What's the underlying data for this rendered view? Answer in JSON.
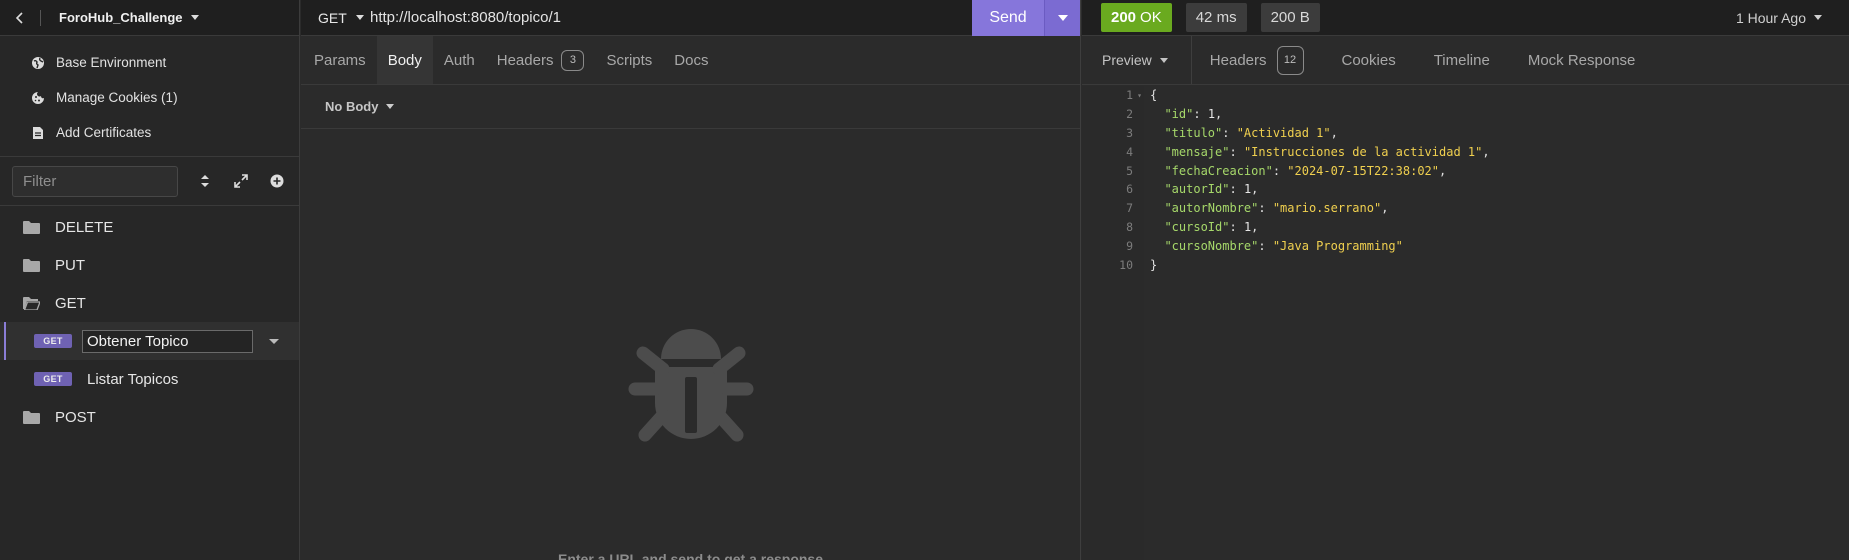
{
  "app": {
    "project_name": "ForoHub_Challenge"
  },
  "sidebar": {
    "menu": [
      {
        "label": "Base Environment",
        "icon": "globe-icon"
      },
      {
        "label": "Manage Cookies (1)",
        "icon": "cookie-icon"
      },
      {
        "label": "Add Certificates",
        "icon": "certificate-icon"
      }
    ],
    "filter_placeholder": "Filter",
    "tree": [
      {
        "type": "folder",
        "label": "DELETE",
        "open": false
      },
      {
        "type": "folder",
        "label": "PUT",
        "open": false
      },
      {
        "type": "folder",
        "label": "GET",
        "open": true
      },
      {
        "type": "request",
        "method": "GET",
        "label": "Obtener Topico",
        "active": true,
        "editing": true
      },
      {
        "type": "request",
        "method": "GET",
        "label": "Listar Topicos",
        "active": false
      },
      {
        "type": "folder",
        "label": "POST",
        "open": false
      }
    ]
  },
  "request": {
    "method": "GET",
    "url": "http://localhost:8080/topico/1",
    "send_label": "Send",
    "tabs": [
      {
        "label": "Params",
        "active": false
      },
      {
        "label": "Body",
        "active": true
      },
      {
        "label": "Auth",
        "active": false
      },
      {
        "label": "Headers",
        "active": false,
        "count": "3"
      },
      {
        "label": "Scripts",
        "active": false
      },
      {
        "label": "Docs",
        "active": false
      }
    ],
    "body_type": "No Body",
    "empty_hint": "Enter a URL and send to get a response"
  },
  "response": {
    "status": {
      "code": "200",
      "text": "OK"
    },
    "time": "42 ms",
    "size": "200 B",
    "time_ago": "1 Hour Ago",
    "preview_label": "Preview",
    "tabs": [
      {
        "label": "Headers",
        "count": "12"
      },
      {
        "label": "Cookies"
      },
      {
        "label": "Timeline"
      },
      {
        "label": "Mock Response"
      }
    ],
    "json_lines": [
      {
        "n": "1",
        "fold": true,
        "parts": [
          {
            "t": "p",
            "v": "{"
          }
        ]
      },
      {
        "n": "2",
        "parts": [
          {
            "t": "p",
            "v": "  "
          },
          {
            "t": "k",
            "v": "\"id\""
          },
          {
            "t": "p",
            "v": ": "
          },
          {
            "t": "n",
            "v": "1"
          },
          {
            "t": "p",
            "v": ","
          }
        ]
      },
      {
        "n": "3",
        "parts": [
          {
            "t": "p",
            "v": "  "
          },
          {
            "t": "k",
            "v": "\"titulo\""
          },
          {
            "t": "p",
            "v": ": "
          },
          {
            "t": "s",
            "v": "\"Actividad 1\""
          },
          {
            "t": "p",
            "v": ","
          }
        ]
      },
      {
        "n": "4",
        "parts": [
          {
            "t": "p",
            "v": "  "
          },
          {
            "t": "k",
            "v": "\"mensaje\""
          },
          {
            "t": "p",
            "v": ": "
          },
          {
            "t": "s",
            "v": "\"Instrucciones de la actividad 1\""
          },
          {
            "t": "p",
            "v": ","
          }
        ]
      },
      {
        "n": "5",
        "parts": [
          {
            "t": "p",
            "v": "  "
          },
          {
            "t": "k",
            "v": "\"fechaCreacion\""
          },
          {
            "t": "p",
            "v": ": "
          },
          {
            "t": "s",
            "v": "\"2024-07-15T22:38:02\""
          },
          {
            "t": "p",
            "v": ","
          }
        ]
      },
      {
        "n": "6",
        "parts": [
          {
            "t": "p",
            "v": "  "
          },
          {
            "t": "k",
            "v": "\"autorId\""
          },
          {
            "t": "p",
            "v": ": "
          },
          {
            "t": "n",
            "v": "1"
          },
          {
            "t": "p",
            "v": ","
          }
        ]
      },
      {
        "n": "7",
        "parts": [
          {
            "t": "p",
            "v": "  "
          },
          {
            "t": "k",
            "v": "\"autorNombre\""
          },
          {
            "t": "p",
            "v": ": "
          },
          {
            "t": "s",
            "v": "\"mario.serrano\""
          },
          {
            "t": "p",
            "v": ","
          }
        ]
      },
      {
        "n": "8",
        "parts": [
          {
            "t": "p",
            "v": "  "
          },
          {
            "t": "k",
            "v": "\"cursoId\""
          },
          {
            "t": "p",
            "v": ": "
          },
          {
            "t": "n",
            "v": "1"
          },
          {
            "t": "p",
            "v": ","
          }
        ]
      },
      {
        "n": "9",
        "parts": [
          {
            "t": "p",
            "v": "  "
          },
          {
            "t": "k",
            "v": "\"cursoNombre\""
          },
          {
            "t": "p",
            "v": ": "
          },
          {
            "t": "s",
            "v": "\"Java Programming\""
          }
        ]
      },
      {
        "n": "10",
        "parts": [
          {
            "t": "p",
            "v": "}"
          }
        ]
      }
    ]
  },
  "colors": {
    "accent": "#8676db",
    "status_ok": "#6aaa1f",
    "json_key": "#a6d86a",
    "json_string": "#f0d04f"
  }
}
